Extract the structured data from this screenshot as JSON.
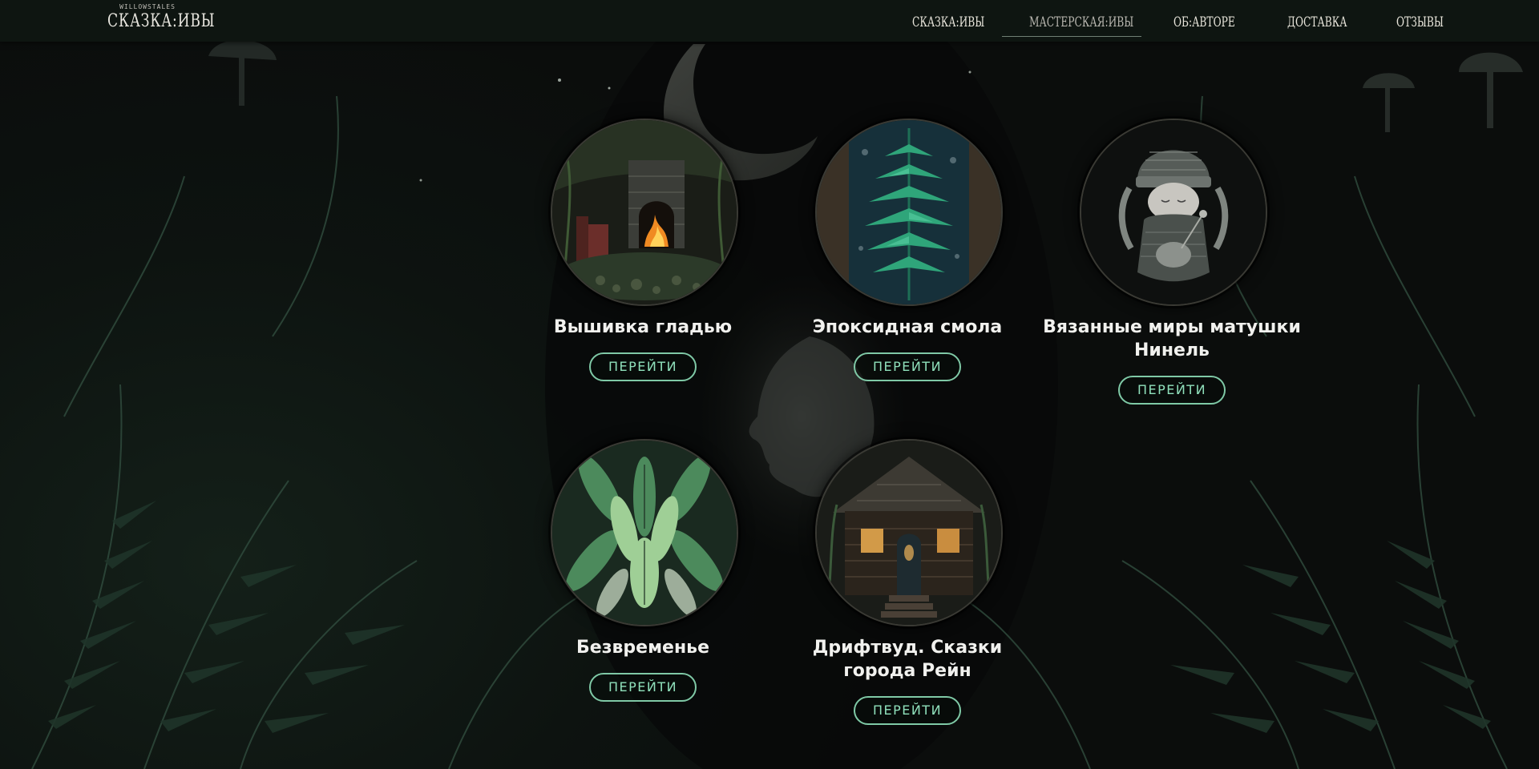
{
  "header": {
    "logo": {
      "subtitle": "WILLOWSTALES",
      "title": "СКАЗКА:ИВЫ"
    },
    "nav": [
      {
        "label": "СКАЗКА:ИВЫ",
        "active": false
      },
      {
        "label": "МАСТЕРСКАЯ:ИВЫ",
        "active": true
      },
      {
        "label": "ОБ:АВТОРЕ",
        "active": false
      },
      {
        "label": "ДОСТАВКА",
        "active": false
      },
      {
        "label": "ОТЗЫВЫ",
        "active": false
      }
    ]
  },
  "workshops": [
    {
      "title": "Вышивка гладью",
      "button": "ПЕРЕЙТИ",
      "image": "embroidery-fireplace"
    },
    {
      "title": "Эпоксидная смола",
      "button": "ПЕРЕЙТИ",
      "image": "fern-leaf"
    },
    {
      "title": "Вязанные миры матушки Нинель",
      "button": "ПЕРЕЙТИ",
      "image": "knitted-doll"
    },
    {
      "title": "Безвременье",
      "button": "ПЕРЕЙТИ",
      "image": "green-leaves"
    },
    {
      "title": "Дрифтвуд. Сказки города Рейн",
      "button": "ПЕРЕЙТИ",
      "image": "forest-hut"
    }
  ],
  "colors": {
    "accent": "#8fe0bb",
    "background": "#0c0f0d",
    "nav_background": "#0e1511"
  }
}
